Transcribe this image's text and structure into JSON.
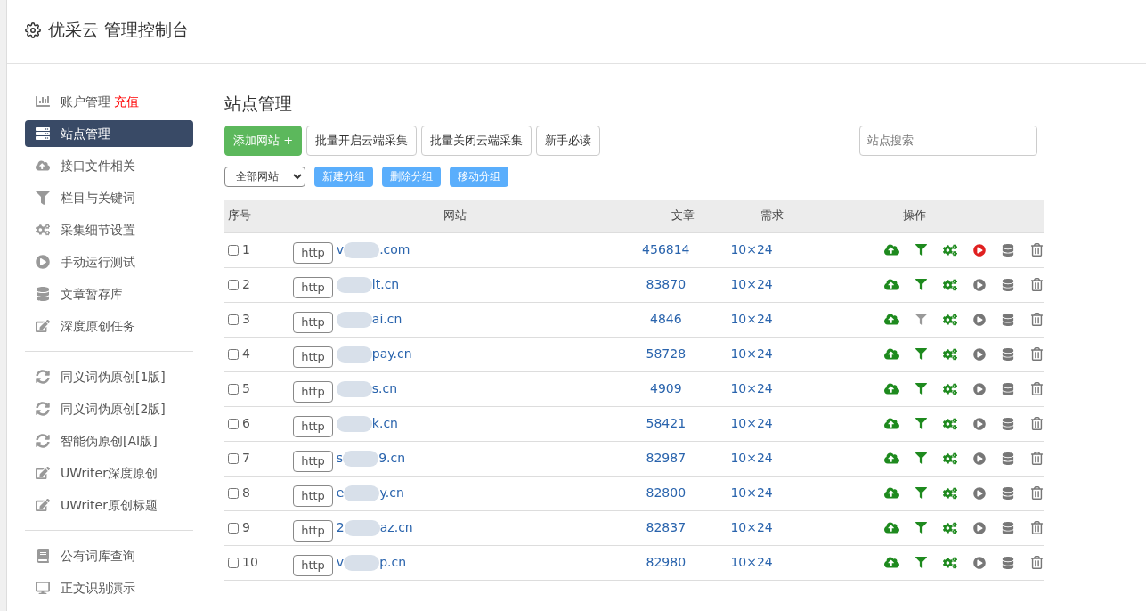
{
  "header": {
    "title": "优采云 管理控制台"
  },
  "sidebar": {
    "groups": [
      {
        "items": [
          {
            "kind": "chart",
            "label": "账户管理",
            "badge": "充值",
            "selected": false
          },
          {
            "kind": "server",
            "label": "站点管理",
            "selected": true
          },
          {
            "kind": "cloud",
            "label": "接口文件相关",
            "selected": false
          },
          {
            "kind": "filter",
            "label": "栏目与关键词",
            "selected": false
          },
          {
            "kind": "cogs",
            "label": "采集细节设置",
            "selected": false
          },
          {
            "kind": "play",
            "label": "手动运行测试",
            "selected": false
          },
          {
            "kind": "database",
            "label": "文章暂存库",
            "selected": false
          },
          {
            "kind": "edit",
            "label": "深度原创任务",
            "selected": false
          }
        ]
      },
      {
        "items": [
          {
            "kind": "sync",
            "label": "同义词伪原创[1版]",
            "selected": false
          },
          {
            "kind": "sync",
            "label": "同义词伪原创[2版]",
            "selected": false
          },
          {
            "kind": "sync",
            "label": "智能伪原创[AI版]",
            "selected": false
          },
          {
            "kind": "edit",
            "label": "UWriter深度原创",
            "selected": false
          },
          {
            "kind": "edit",
            "label": "UWriter原创标题",
            "selected": false
          }
        ]
      },
      {
        "items": [
          {
            "kind": "book",
            "label": "公有词库查询",
            "selected": false
          },
          {
            "kind": "desktop",
            "label": "正文识别演示",
            "selected": false
          }
        ]
      }
    ]
  },
  "main": {
    "title": "站点管理",
    "toolbar": [
      {
        "kind": "primary",
        "label": "添加网站 +"
      },
      {
        "kind": "default",
        "label": "批量开启云端采集"
      },
      {
        "kind": "default",
        "label": "批量关闭云端采集"
      },
      {
        "kind": "default",
        "label": "新手必读"
      }
    ],
    "search": {
      "placeholder": "站点搜索"
    },
    "group_select": {
      "value": "全部网站"
    },
    "group_buttons": [
      "新建分组",
      "删除分组",
      "移动分组"
    ],
    "table": {
      "columns": [
        "序号",
        "网站",
        "文章",
        "需求",
        "操作"
      ],
      "rows": [
        {
          "index": "1",
          "checked": false,
          "scheme": "http",
          "domain_start": "v",
          "domain_end": ".com",
          "articles": "456814",
          "demand": "10×24",
          "filter_on": true,
          "running": true
        },
        {
          "index": "2",
          "checked": false,
          "scheme": "http",
          "domain_end": "lt.cn",
          "articles": "83870",
          "demand": "10×24",
          "filter_on": true,
          "running": false
        },
        {
          "index": "3",
          "checked": false,
          "scheme": "http",
          "domain_end": "ai.cn",
          "articles": "4846",
          "demand": "10×24",
          "filter_on": false,
          "running": false
        },
        {
          "index": "4",
          "checked": false,
          "scheme": "http",
          "domain_end": "pay.cn",
          "articles": "58728",
          "demand": "10×24",
          "filter_on": true,
          "running": false
        },
        {
          "index": "5",
          "checked": false,
          "scheme": "http",
          "domain_end": "s.cn",
          "articles": "4909",
          "demand": "10×24",
          "filter_on": true,
          "running": false
        },
        {
          "index": "6",
          "checked": false,
          "scheme": "http",
          "domain_end": "k.cn",
          "articles": "58421",
          "demand": "10×24",
          "filter_on": true,
          "running": false
        },
        {
          "index": "7",
          "checked": false,
          "scheme": "http",
          "domain_start": "s",
          "domain_end": "9.cn",
          "articles": "82987",
          "demand": "10×24",
          "filter_on": true,
          "running": false
        },
        {
          "index": "8",
          "checked": false,
          "scheme": "http",
          "domain_start": "e",
          "domain_end": "y.cn",
          "articles": "82800",
          "demand": "10×24",
          "filter_on": true,
          "running": false
        },
        {
          "index": "9",
          "checked": false,
          "scheme": "http",
          "domain_start": "2",
          "domain_end": "az.cn",
          "articles": "82837",
          "demand": "10×24",
          "filter_on": true,
          "running": false
        },
        {
          "index": "10",
          "checked": false,
          "scheme": "http",
          "domain_start": "v",
          "domain_end": "p.cn",
          "articles": "82980",
          "demand": "10×24",
          "filter_on": true,
          "running": false
        }
      ]
    }
  }
}
